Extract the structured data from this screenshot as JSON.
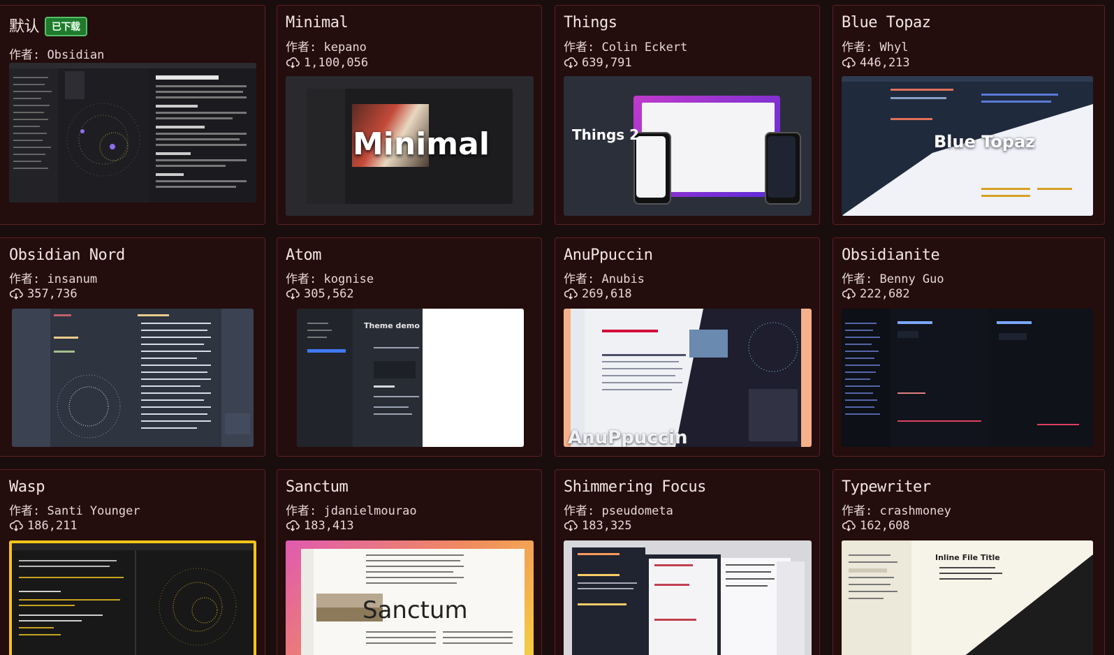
{
  "themes": [
    {
      "name": "默认",
      "badge": "已下载",
      "author_prefix": "作者:",
      "author": "Obsidian",
      "downloads": ""
    },
    {
      "name": "Minimal",
      "author_prefix": "作者:",
      "author": "kepano",
      "downloads": "1,100,056",
      "preview_label": "Minimal"
    },
    {
      "name": "Things",
      "author_prefix": "作者:",
      "author": "Colin Eckert",
      "downloads": "639,791",
      "preview_label": "Things 2"
    },
    {
      "name": "Blue Topaz",
      "author_prefix": "作者:",
      "author": "Whyl",
      "downloads": "446,213",
      "preview_label": "Blue Topaz"
    },
    {
      "name": "Obsidian Nord",
      "author_prefix": "作者:",
      "author": "insanum",
      "downloads": "357,736"
    },
    {
      "name": "Atom",
      "author_prefix": "作者:",
      "author": "kognise",
      "downloads": "305,562",
      "preview_label": "Theme demo"
    },
    {
      "name": "AnuPpuccin",
      "author_prefix": "作者:",
      "author": "Anubis",
      "downloads": "269,618",
      "preview_label": "AnuPpuccin"
    },
    {
      "name": "Obsidianite",
      "author_prefix": "作者:",
      "author": "Benny Guo",
      "downloads": "222,682"
    },
    {
      "name": "Wasp",
      "author_prefix": "作者:",
      "author": "Santi Younger",
      "downloads": "186,211"
    },
    {
      "name": "Sanctum",
      "author_prefix": "作者:",
      "author": "jdanielmourao",
      "downloads": "183,413",
      "preview_label": "Sanctum"
    },
    {
      "name": "Shimmering Focus",
      "author_prefix": "作者:",
      "author": "pseudometa",
      "downloads": "183,325"
    },
    {
      "name": "Typewriter",
      "author_prefix": "作者:",
      "author": "crashmoney",
      "downloads": "162,608",
      "preview_label": "Inline File Title"
    }
  ],
  "colors": {
    "background": "#1a0d0d",
    "card": "#240d0d",
    "card_border": "#5e1f22",
    "badge": "#1f7a2e"
  },
  "icons": {
    "downloads": "download-cloud-icon"
  }
}
